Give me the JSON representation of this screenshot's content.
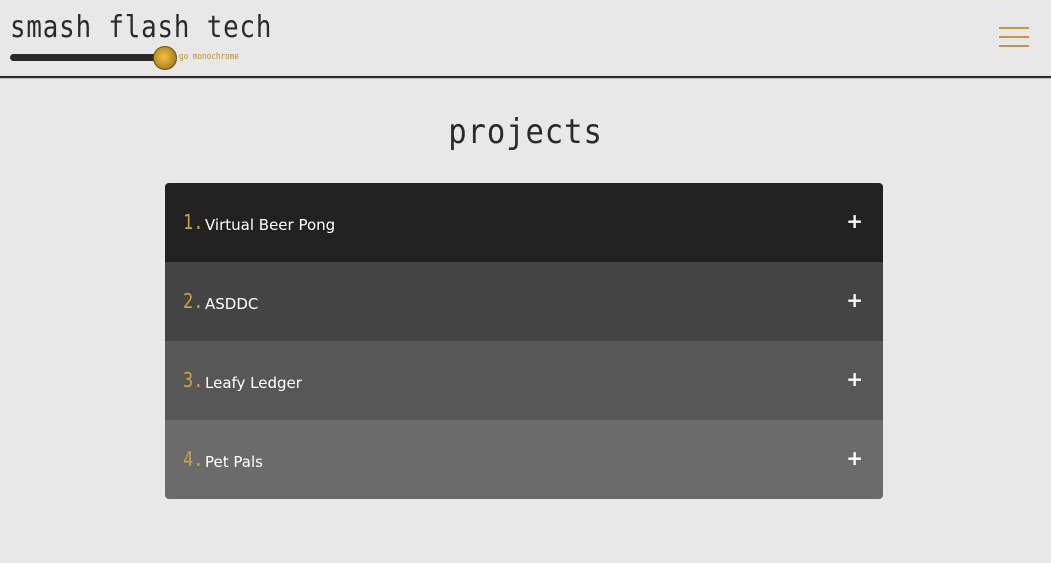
{
  "header": {
    "site_title": "smash flash tech",
    "toggle_label": "go monochrome",
    "menu_icon": "hamburger-menu-icon",
    "accent_color": "#c29a3a"
  },
  "main": {
    "page_title": "projects",
    "projects": [
      {
        "number": "1.",
        "label": "Virtual Beer Pong",
        "expand_icon": "+",
        "bg": "#212121"
      },
      {
        "number": "2.",
        "label": "ASDDC",
        "expand_icon": "+",
        "bg": "#444444"
      },
      {
        "number": "3.",
        "label": "Leafy Ledger",
        "expand_icon": "+",
        "bg": "#575757"
      },
      {
        "number": "4.",
        "label": "Pet Pals",
        "expand_icon": "+",
        "bg": "#6b6b6b"
      }
    ]
  }
}
